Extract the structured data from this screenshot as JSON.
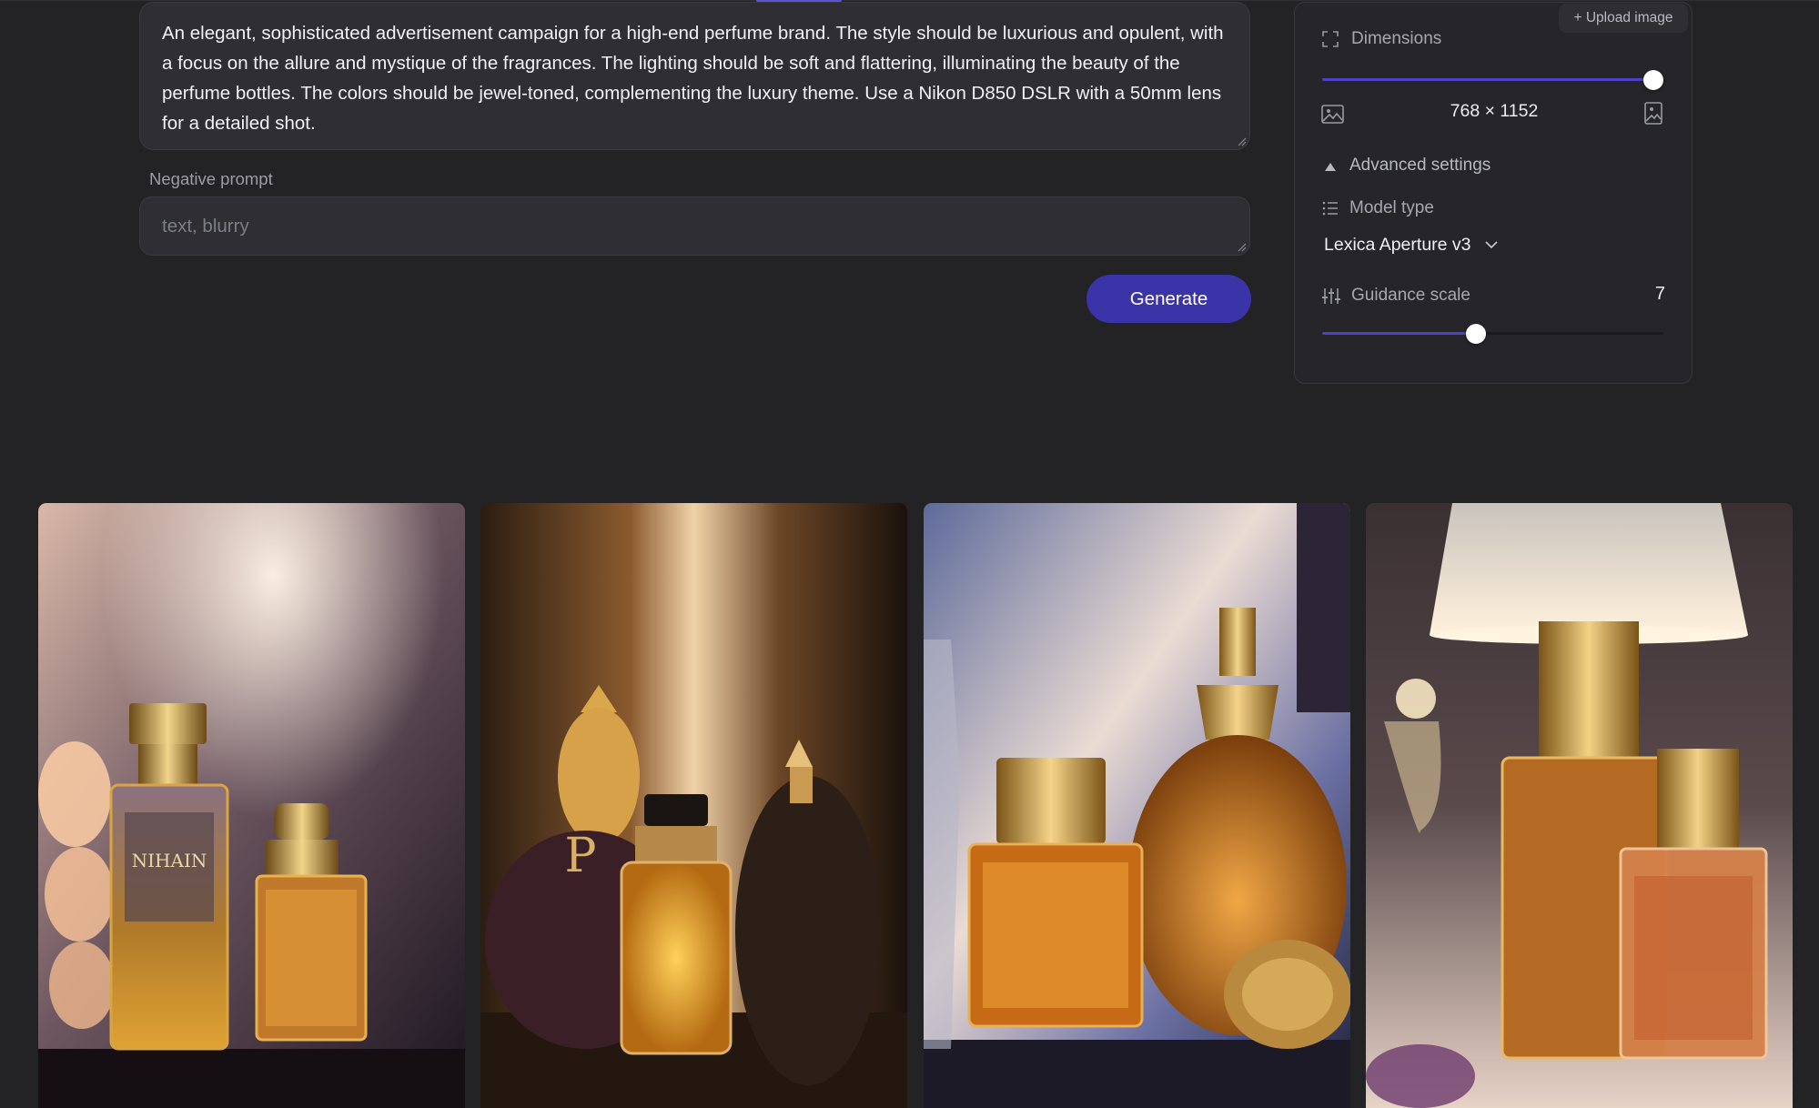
{
  "prompt": {
    "text": "An elegant, sophisticated advertisement campaign for a high-end perfume brand. The style should be luxurious and opulent, with a focus on the allure and mystique of the fragrances. The lighting should be soft and flattering, illuminating the beauty of the perfume bottles. The colors should be jewel-toned, complementing the luxury theme. Use a Nikon D850 DSLR with a 50mm lens for a detailed shot."
  },
  "negative_prompt": {
    "label": "Negative prompt",
    "placeholder": "text, blurry"
  },
  "generate": {
    "label": "Generate"
  },
  "settings": {
    "upload_label": "+ Upload image",
    "dimensions": {
      "label": "Dimensions",
      "value": "768 × 1152",
      "slider_fraction": 1.0
    },
    "advanced": {
      "label": "Advanced settings"
    },
    "model": {
      "label": "Model type",
      "selected": "Lexica Aperture v3"
    },
    "guidance": {
      "label": "Guidance scale",
      "value": "7",
      "slider_fraction": 0.45
    }
  },
  "gallery": {
    "images": [
      {
        "name": "perfume-image-1",
        "label_visible": "NIHAIN"
      },
      {
        "name": "perfume-image-2",
        "label_visible": "P"
      },
      {
        "name": "perfume-image-3"
      },
      {
        "name": "perfume-image-4"
      }
    ]
  },
  "colors": {
    "background": "#232326",
    "panel": "#26262a",
    "input": "#2f2f33",
    "accent": "#4a42c9",
    "button": "#3b34a8"
  }
}
